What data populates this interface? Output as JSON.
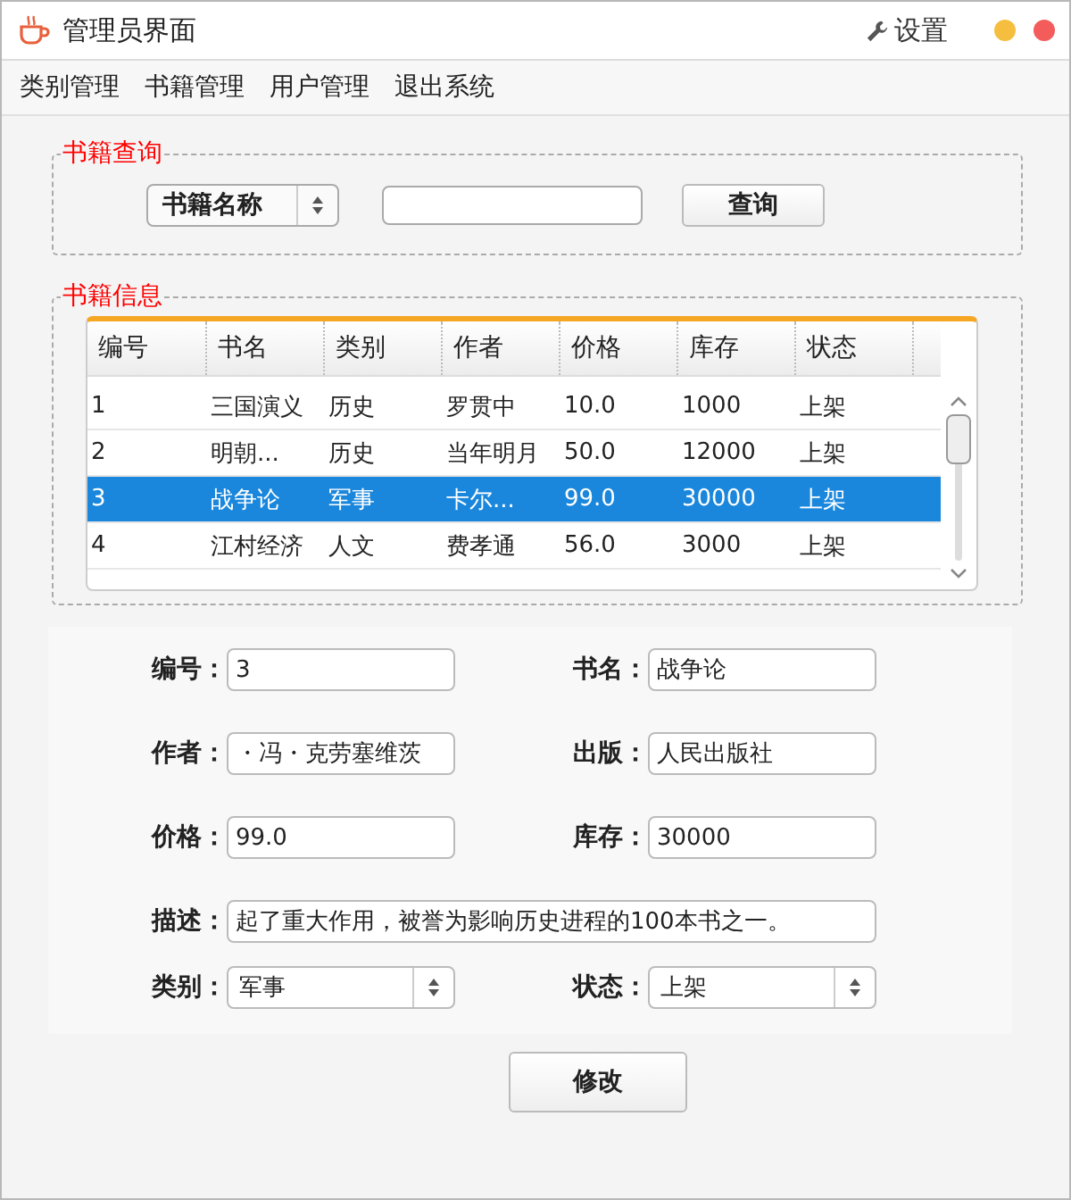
{
  "window": {
    "title": "管理员界面",
    "settings_label": "设置"
  },
  "menu": [
    "类别管理",
    "书籍管理",
    "用户管理",
    "退出系统"
  ],
  "query": {
    "legend": "书籍查询",
    "select_value": "书籍名称",
    "button": "查询"
  },
  "books": {
    "legend": "书籍信息",
    "columns": [
      "编号",
      "书名",
      "类别",
      "作者",
      "价格",
      "库存",
      "状态"
    ],
    "rows": [
      {
        "cells": [
          "1",
          "三国演义",
          "历史",
          "罗贯中",
          "10.0",
          "1000",
          "上架"
        ],
        "selected": false
      },
      {
        "cells": [
          "2",
          "明朝...",
          "历史",
          "当年明月",
          "50.0",
          "12000",
          "上架"
        ],
        "selected": false
      },
      {
        "cells": [
          "3",
          "战争论",
          "军事",
          "卡尔...",
          "99.0",
          "30000",
          "上架"
        ],
        "selected": true
      },
      {
        "cells": [
          "4",
          "江村经济",
          "人文",
          "费孝通",
          "56.0",
          "3000",
          "上架"
        ],
        "selected": false
      }
    ]
  },
  "form": {
    "fields": [
      {
        "label": "编号：",
        "value": "3",
        "kind": "text"
      },
      {
        "label": "书名：",
        "value": "战争论",
        "kind": "text"
      },
      {
        "label": "作者：",
        "value": "・冯・克劳塞维茨",
        "kind": "text"
      },
      {
        "label": "出版：",
        "value": "人民出版社",
        "kind": "text"
      },
      {
        "label": "价格：",
        "value": "99.0",
        "kind": "text"
      },
      {
        "label": "库存：",
        "value": "30000",
        "kind": "text"
      },
      {
        "label": "描述：",
        "value": "起了重大作用，被誉为影响历史进程的100本书之一。",
        "kind": "wide"
      },
      {
        "label": "类别：",
        "value": "军事",
        "kind": "select"
      },
      {
        "label": "状态：",
        "value": "上架",
        "kind": "select"
      }
    ],
    "button": "修改"
  }
}
